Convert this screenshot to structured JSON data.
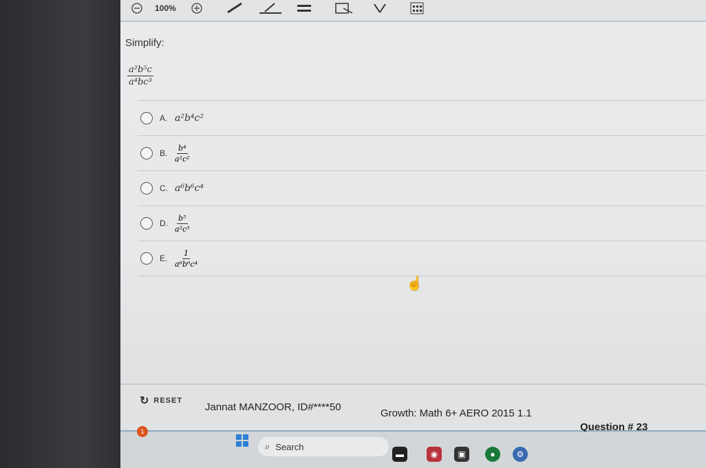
{
  "toolbar": {
    "zoom_label": "100%",
    "zoom_out_icon": "minus-circle-icon",
    "zoom_in_icon": "plus-circle-icon"
  },
  "question": {
    "prompt": "Simplify:",
    "expression": {
      "numerator": "a²b⁵c",
      "denominator": "a⁴bc³"
    },
    "options": [
      {
        "letter": "A.",
        "type": "plain",
        "expr": "a²b⁴c²"
      },
      {
        "letter": "B.",
        "type": "fraction",
        "numerator": "b⁴",
        "denominator": "a²c²"
      },
      {
        "letter": "C.",
        "type": "plain",
        "expr": "a⁶b⁶c⁴"
      },
      {
        "letter": "D.",
        "type": "fraction",
        "numerator": "b⁵",
        "denominator": "a²c³"
      },
      {
        "letter": "E.",
        "type": "fraction",
        "numerator": "1",
        "denominator": "a⁶b⁶c⁴"
      }
    ]
  },
  "footer": {
    "reset_label": "RESET",
    "student": "Jannat MANZOOR, ID#****50",
    "course": "Growth: Math 6+ AERO 2015 1.1",
    "question_number": "Question # 23"
  },
  "taskbar": {
    "search_label": "Search",
    "notification_count": "1"
  },
  "colors": {
    "accent_line": "#8fa9bf",
    "start_blue": "#2d7fd3",
    "badge_orange": "#d9541e"
  }
}
